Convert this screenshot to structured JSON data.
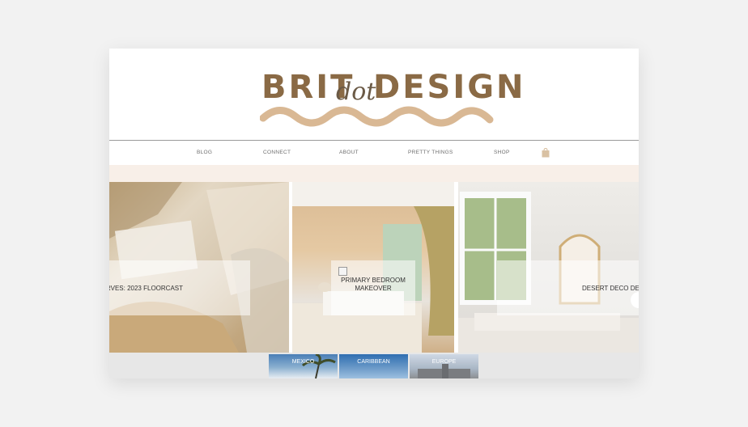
{
  "logo": {
    "word1": "BRIT",
    "word2": "dot",
    "word3": "DESIGN",
    "color": "#8a6a45",
    "wave_color": "#d9b894"
  },
  "nav": {
    "items": [
      "BLOG",
      "CONNECT",
      "ABOUT",
      "PRETTY THINGS",
      "SHOP"
    ],
    "cart_icon": "shopping-bag-icon"
  },
  "gallery": {
    "tiles": [
      {
        "title": "RVES: 2023 FLOORCAST"
      },
      {
        "title": "PRIMARY BEDROOM MAKEOVER"
      },
      {
        "title": "DESERT DECO DEN"
      }
    ]
  },
  "destinations": [
    "MEXICO",
    "CARIBBEAN",
    "EUROPE"
  ],
  "colors": {
    "band": "#f8efe8",
    "background": "#f2f2f2"
  }
}
